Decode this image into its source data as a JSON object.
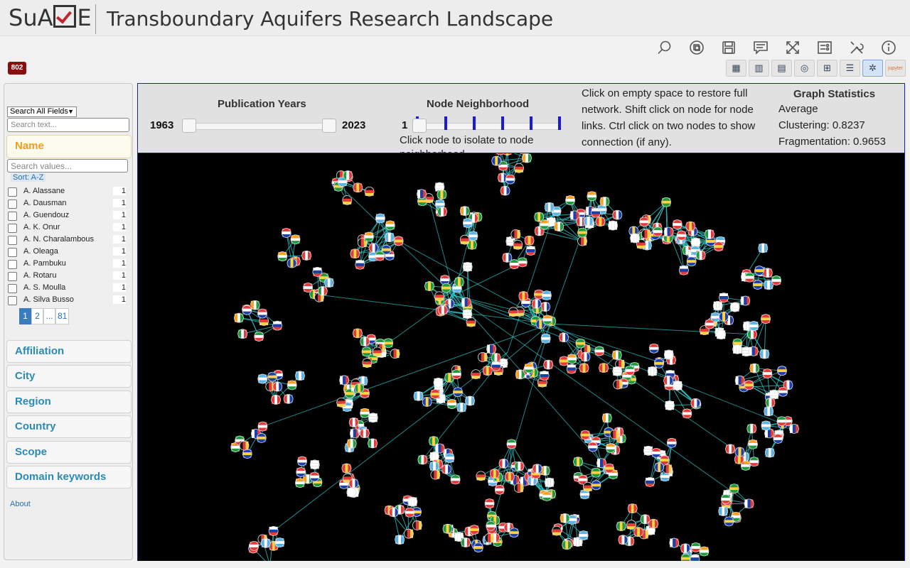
{
  "header": {
    "logo_text_left": "SuA",
    "logo_text_right": "E",
    "title": "Transboundary Aquifers Research Landscape"
  },
  "toolbar": {
    "icons": [
      "search-icon",
      "copy-icon",
      "save-icon",
      "comment-icon",
      "fullscreen-icon",
      "settings-list-icon",
      "tools-icon",
      "info-icon"
    ]
  },
  "record_count": "802",
  "view_buttons": [
    "grid-view",
    "bar-chart-view",
    "table-view",
    "map-view",
    "spreadsheet-view",
    "list-view",
    "network-view",
    "jupyter-view"
  ],
  "active_view": "network-view",
  "jupyter_label": "jupyter",
  "sidebar": {
    "field_select": "Search All Fields",
    "search_placeholder": "Search text...",
    "name_facet": {
      "label": "Name",
      "value_search_placeholder": "Search values...",
      "sort_label": "Sort: A-Z",
      "rows": [
        {
          "name": "A. Alassane",
          "count": "1"
        },
        {
          "name": "A. Dausman",
          "count": "1"
        },
        {
          "name": "A. Guendouz",
          "count": "1"
        },
        {
          "name": "A. K. Onur",
          "count": "1"
        },
        {
          "name": "A. N. Charalambous",
          "count": "1"
        },
        {
          "name": "A. Oleaga",
          "count": "1"
        },
        {
          "name": "A. Pambuku",
          "count": "1"
        },
        {
          "name": "A. Rotaru",
          "count": "1"
        },
        {
          "name": "A. S. Moulla",
          "count": "1"
        },
        {
          "name": "A. Silva Busso",
          "count": "1"
        }
      ],
      "pages": [
        "1",
        "2",
        "...",
        "81"
      ]
    },
    "facets": [
      "Affiliation",
      "City",
      "Region",
      "Country",
      "Scope",
      "Domain keywords"
    ],
    "about_link": "About"
  },
  "controls": {
    "pub_years_title": "Publication Years",
    "year_min": "1963",
    "year_max": "2023",
    "node_neighborhood_title": "Node Neighborhood",
    "neighborhood_value": "1",
    "neighborhood_hint": "Click node to isolate to node neighborhood.",
    "help_text": "Click on empty space to restore full network. Shift click on node for node links. Ctrl click on two nodes to show connection (if any).",
    "stats_title": "Graph Statistics",
    "stat_average": "Average",
    "stat_clustering": "Clustering: 0.8237",
    "stat_fragmentation": "Fragmentation: 0.9653"
  },
  "graph": {
    "background": "#000000",
    "edge_color": "#2fd0d0"
  }
}
